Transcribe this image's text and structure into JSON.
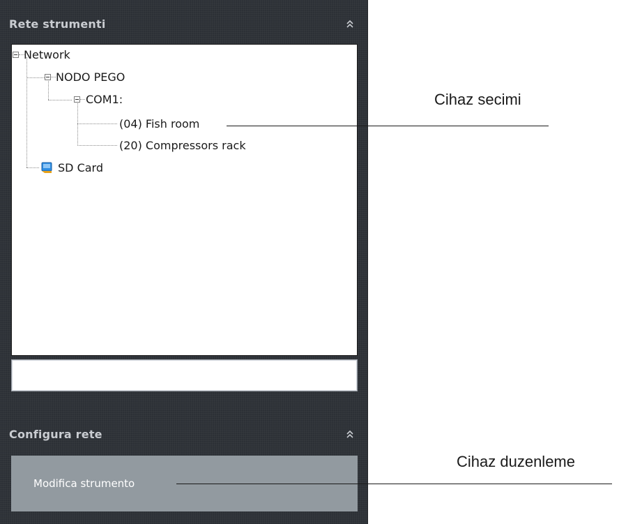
{
  "panels": {
    "network": {
      "title": "Rete strumenti"
    },
    "config": {
      "title": "Configura rete",
      "items": [
        {
          "label": "Modifica strumento"
        }
      ]
    }
  },
  "tree": {
    "root": "Network",
    "node": "NODO PEGO",
    "port": "COM1:",
    "devices": [
      "(04) Fish room",
      "(20) Compressors rack"
    ],
    "sd_card": "SD Card"
  },
  "search": {
    "value": "",
    "placeholder": ""
  },
  "annotations": {
    "device_select": "Cihaz secimi",
    "device_edit": "Cihaz duzenleme"
  },
  "icons": {
    "collapse": "double-chevron-up-icon",
    "expander": "minus-box-icon",
    "sd_card": "sd-card-icon"
  },
  "colors": {
    "panel_bg": "#2c3036",
    "header_text": "#c9ccd1",
    "menu_item_bg": "#929aa0",
    "sd_icon": "#2f8ee3"
  }
}
